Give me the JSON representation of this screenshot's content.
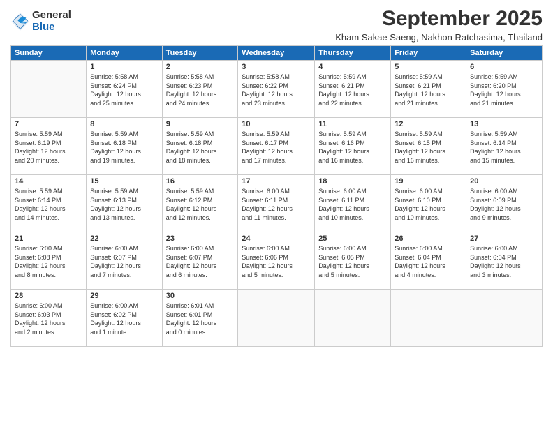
{
  "logo": {
    "general": "General",
    "blue": "Blue"
  },
  "header": {
    "title": "September 2025",
    "location": "Kham Sakae Saeng, Nakhon Ratchasima, Thailand"
  },
  "weekdays": [
    "Sunday",
    "Monday",
    "Tuesday",
    "Wednesday",
    "Thursday",
    "Friday",
    "Saturday"
  ],
  "weeks": [
    [
      {
        "day": "",
        "text": ""
      },
      {
        "day": "1",
        "text": "Sunrise: 5:58 AM\nSunset: 6:24 PM\nDaylight: 12 hours\nand 25 minutes."
      },
      {
        "day": "2",
        "text": "Sunrise: 5:58 AM\nSunset: 6:23 PM\nDaylight: 12 hours\nand 24 minutes."
      },
      {
        "day": "3",
        "text": "Sunrise: 5:58 AM\nSunset: 6:22 PM\nDaylight: 12 hours\nand 23 minutes."
      },
      {
        "day": "4",
        "text": "Sunrise: 5:59 AM\nSunset: 6:21 PM\nDaylight: 12 hours\nand 22 minutes."
      },
      {
        "day": "5",
        "text": "Sunrise: 5:59 AM\nSunset: 6:21 PM\nDaylight: 12 hours\nand 21 minutes."
      },
      {
        "day": "6",
        "text": "Sunrise: 5:59 AM\nSunset: 6:20 PM\nDaylight: 12 hours\nand 21 minutes."
      }
    ],
    [
      {
        "day": "7",
        "text": "Sunrise: 5:59 AM\nSunset: 6:19 PM\nDaylight: 12 hours\nand 20 minutes."
      },
      {
        "day": "8",
        "text": "Sunrise: 5:59 AM\nSunset: 6:18 PM\nDaylight: 12 hours\nand 19 minutes."
      },
      {
        "day": "9",
        "text": "Sunrise: 5:59 AM\nSunset: 6:18 PM\nDaylight: 12 hours\nand 18 minutes."
      },
      {
        "day": "10",
        "text": "Sunrise: 5:59 AM\nSunset: 6:17 PM\nDaylight: 12 hours\nand 17 minutes."
      },
      {
        "day": "11",
        "text": "Sunrise: 5:59 AM\nSunset: 6:16 PM\nDaylight: 12 hours\nand 16 minutes."
      },
      {
        "day": "12",
        "text": "Sunrise: 5:59 AM\nSunset: 6:15 PM\nDaylight: 12 hours\nand 16 minutes."
      },
      {
        "day": "13",
        "text": "Sunrise: 5:59 AM\nSunset: 6:14 PM\nDaylight: 12 hours\nand 15 minutes."
      }
    ],
    [
      {
        "day": "14",
        "text": "Sunrise: 5:59 AM\nSunset: 6:14 PM\nDaylight: 12 hours\nand 14 minutes."
      },
      {
        "day": "15",
        "text": "Sunrise: 5:59 AM\nSunset: 6:13 PM\nDaylight: 12 hours\nand 13 minutes."
      },
      {
        "day": "16",
        "text": "Sunrise: 5:59 AM\nSunset: 6:12 PM\nDaylight: 12 hours\nand 12 minutes."
      },
      {
        "day": "17",
        "text": "Sunrise: 6:00 AM\nSunset: 6:11 PM\nDaylight: 12 hours\nand 11 minutes."
      },
      {
        "day": "18",
        "text": "Sunrise: 6:00 AM\nSunset: 6:11 PM\nDaylight: 12 hours\nand 10 minutes."
      },
      {
        "day": "19",
        "text": "Sunrise: 6:00 AM\nSunset: 6:10 PM\nDaylight: 12 hours\nand 10 minutes."
      },
      {
        "day": "20",
        "text": "Sunrise: 6:00 AM\nSunset: 6:09 PM\nDaylight: 12 hours\nand 9 minutes."
      }
    ],
    [
      {
        "day": "21",
        "text": "Sunrise: 6:00 AM\nSunset: 6:08 PM\nDaylight: 12 hours\nand 8 minutes."
      },
      {
        "day": "22",
        "text": "Sunrise: 6:00 AM\nSunset: 6:07 PM\nDaylight: 12 hours\nand 7 minutes."
      },
      {
        "day": "23",
        "text": "Sunrise: 6:00 AM\nSunset: 6:07 PM\nDaylight: 12 hours\nand 6 minutes."
      },
      {
        "day": "24",
        "text": "Sunrise: 6:00 AM\nSunset: 6:06 PM\nDaylight: 12 hours\nand 5 minutes."
      },
      {
        "day": "25",
        "text": "Sunrise: 6:00 AM\nSunset: 6:05 PM\nDaylight: 12 hours\nand 5 minutes."
      },
      {
        "day": "26",
        "text": "Sunrise: 6:00 AM\nSunset: 6:04 PM\nDaylight: 12 hours\nand 4 minutes."
      },
      {
        "day": "27",
        "text": "Sunrise: 6:00 AM\nSunset: 6:04 PM\nDaylight: 12 hours\nand 3 minutes."
      }
    ],
    [
      {
        "day": "28",
        "text": "Sunrise: 6:00 AM\nSunset: 6:03 PM\nDaylight: 12 hours\nand 2 minutes."
      },
      {
        "day": "29",
        "text": "Sunrise: 6:00 AM\nSunset: 6:02 PM\nDaylight: 12 hours\nand 1 minute."
      },
      {
        "day": "30",
        "text": "Sunrise: 6:01 AM\nSunset: 6:01 PM\nDaylight: 12 hours\nand 0 minutes."
      },
      {
        "day": "",
        "text": ""
      },
      {
        "day": "",
        "text": ""
      },
      {
        "day": "",
        "text": ""
      },
      {
        "day": "",
        "text": ""
      }
    ]
  ]
}
